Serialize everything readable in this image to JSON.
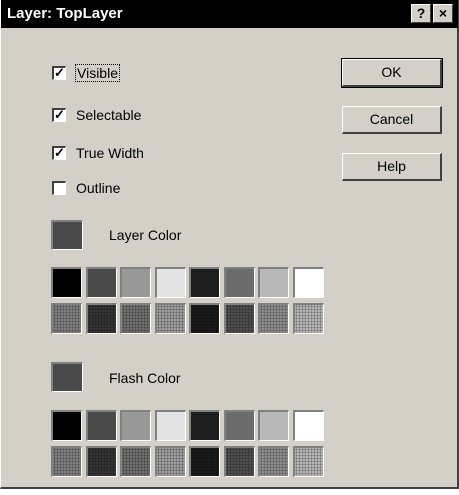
{
  "window": {
    "title": "Layer: TopLayer",
    "help_glyph": "?",
    "close_glyph": "×"
  },
  "options": [
    {
      "label": "Visible",
      "checked": true
    },
    {
      "label": "Selectable",
      "checked": true
    },
    {
      "label": "True Width",
      "checked": true
    },
    {
      "label": "Outline",
      "checked": false
    }
  ],
  "buttons": {
    "ok": "OK",
    "cancel": "Cancel",
    "help": "Help"
  },
  "layer_color": {
    "label": "Layer Color",
    "selected": "#4a4a4a"
  },
  "flash_color": {
    "label": "Flash Color",
    "selected": "#4a4a4a"
  },
  "palette": {
    "row1": [
      "#000000",
      "#4a4a4a",
      "#999999",
      "#e4e4e4",
      "#1e1e1e",
      "#6c6c6c",
      "#b8b8b8",
      "#ffffff"
    ],
    "row2": [
      "#7e7e7e",
      "#343434",
      "#6e6e6e",
      "#9c9c9c",
      "#1a1a1a",
      "#4e4e4e",
      "#8c8c8c",
      "#b4b4b4"
    ]
  }
}
